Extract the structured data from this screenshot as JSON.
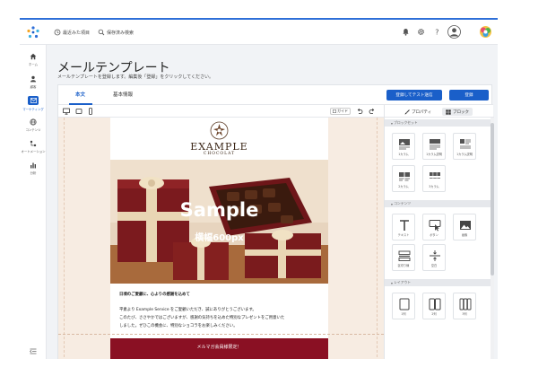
{
  "topbar": {
    "recent_label": "最近みた項目",
    "saved_search_label": "保存済み検索"
  },
  "sidebar": {
    "items": [
      {
        "label": "ホーム",
        "icon": "home-icon"
      },
      {
        "label": "顧客",
        "icon": "person-icon"
      },
      {
        "label": "マーケティング",
        "icon": "mail-icon",
        "active": true
      },
      {
        "label": "コンテンツ",
        "icon": "globe-icon"
      },
      {
        "label": "オートメーション",
        "icon": "automation-icon"
      },
      {
        "label": "分析",
        "icon": "chart-icon"
      }
    ]
  },
  "page": {
    "title": "メールテンプレート",
    "subtitle": "メールテンプレートを登録します。編集後「登録」をクリックしてください。"
  },
  "tabs": [
    "本文",
    "基本情報"
  ],
  "actions": {
    "test_send_label": "登録してテスト送信",
    "register_label": "登録"
  },
  "toolbar": {
    "guide_label": "ガイド"
  },
  "email": {
    "brand_name": "EXAMPLE",
    "brand_sub": "CHOCOLAT",
    "hero_text": "Sample",
    "hero_subtext": "横幅600px",
    "greeting": "日頃のご愛顧に、心よりの感謝を込めて",
    "paragraph": [
      "平素より Example Service をご愛顧いただき、誠にありがとうございます。",
      "このたび、ささやかではございますが、感謝の気持ちを込めた特別なプレゼントをご用意いた",
      "しました。ぜひこの機会に、特別なショコラをお楽しみください。"
    ],
    "banner_text": "メルマガ会員様限定！"
  },
  "panel": {
    "tabs": [
      "プロパティ",
      "ブロック"
    ],
    "sections": [
      {
        "title": "ブロックセット",
        "items": [
          "1カラム",
          "1カラム説明",
          "1カラム説明",
          "2カラム",
          "3カラム"
        ]
      },
      {
        "title": "コンテンツ",
        "items": [
          "テキスト",
          "ボタン",
          "画像",
          "区切り線",
          "空白"
        ]
      },
      {
        "title": "レイアウト",
        "items": [
          "1列",
          "2列",
          "3列"
        ]
      }
    ]
  },
  "colors": {
    "accent": "#1a5fc9",
    "banner": "#8a1023",
    "canvas_bg": "#f7ece2"
  }
}
